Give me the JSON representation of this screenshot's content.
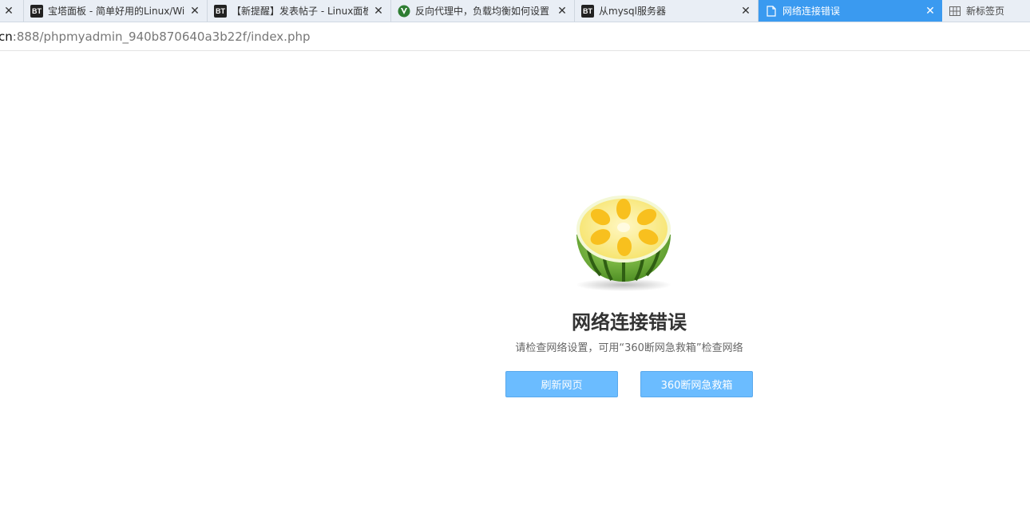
{
  "tabs": [
    {
      "title": "",
      "favicon": "none",
      "active": false
    },
    {
      "title": "宝塔面板 - 简单好用的Linux/Wi",
      "favicon": "bt-logo-icon",
      "active": false
    },
    {
      "title": "【新提醒】发表帖子 - Linux面板",
      "favicon": "bt-logo-icon",
      "active": false
    },
    {
      "title": "反向代理中，负载均衡如何设置",
      "favicon": "shield-logo-icon",
      "active": false
    },
    {
      "title": "从mysql服务器",
      "favicon": "bt-logo-icon",
      "active": false
    },
    {
      "title": "网络连接错误",
      "favicon": "page-icon",
      "active": true
    },
    {
      "title": "新标签页",
      "favicon": "grid-icon",
      "active": false
    }
  ],
  "favicon_text": "BT",
  "close_glyph": "✕",
  "address": {
    "host_visible": "cn",
    "path": ":888/phpmyadmin_940b870640a3b22f/index.php"
  },
  "error": {
    "illustration": "lemon-watermelon-icon",
    "title": "网络连接错误",
    "description": "请检查网络设置，可用“360断网急救箱”检查网络",
    "refresh_button": "刷新网页",
    "rescue_button": "360断网急救箱"
  },
  "colors": {
    "active_tab": "#3a9af0",
    "tabbar_bg": "#e9eef5",
    "button_bg": "#6bbcff"
  }
}
